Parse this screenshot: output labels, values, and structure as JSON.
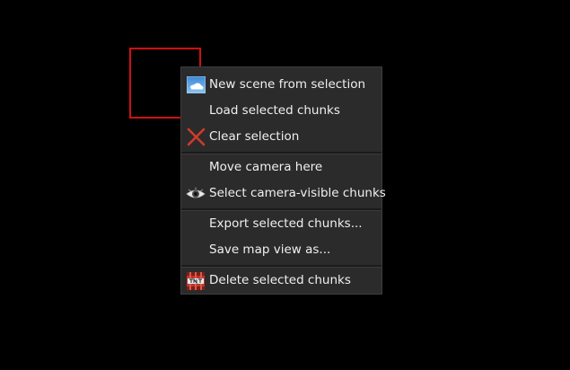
{
  "selection": {
    "color": "#d01010"
  },
  "menu": {
    "groups": [
      [
        {
          "label": "New scene from selection",
          "icon": "sky-scene-icon"
        },
        {
          "label": "Load selected chunks",
          "icon": ""
        },
        {
          "label": "Clear selection",
          "icon": "red-x-icon"
        }
      ],
      [
        {
          "label": "Move camera here",
          "icon": ""
        },
        {
          "label": "Select camera-visible chunks",
          "icon": "eye-icon"
        }
      ],
      [
        {
          "label": "Export selected chunks...",
          "icon": ""
        },
        {
          "label": "Save map view as...",
          "icon": ""
        }
      ],
      [
        {
          "label": "Delete selected chunks",
          "icon": "tnt-icon"
        }
      ]
    ]
  },
  "colors": {
    "menu_bg": "#2b2b2b",
    "text": "#f0f0f0",
    "accent_red": "#d01010"
  }
}
